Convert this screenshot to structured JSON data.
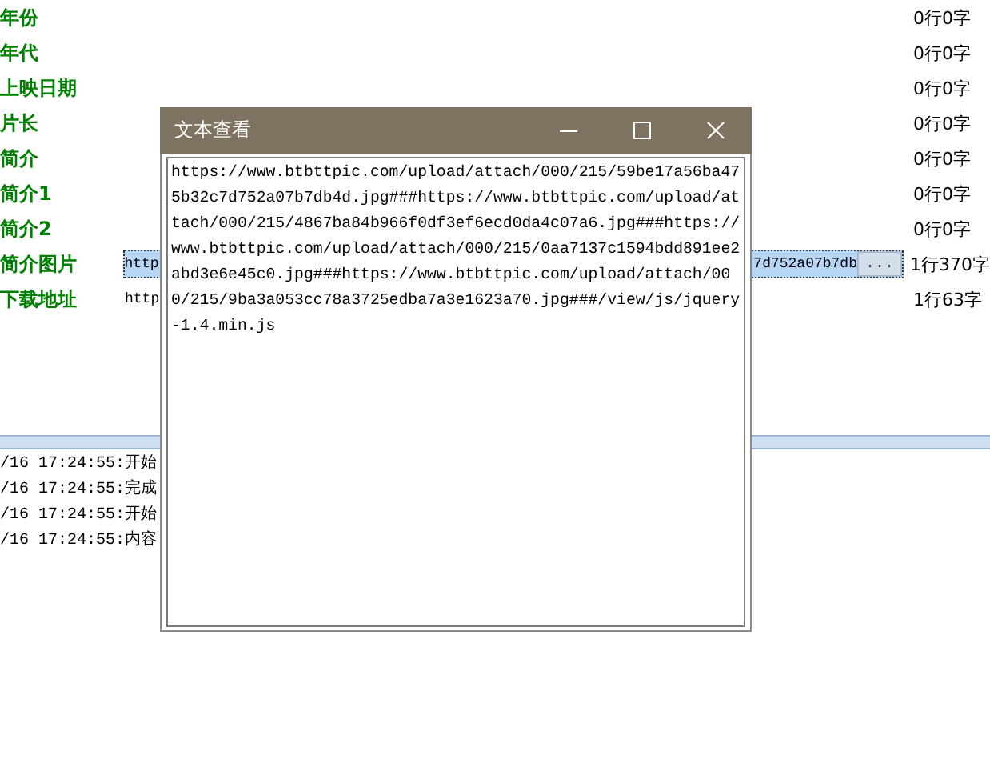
{
  "fields": [
    {
      "label": "年份",
      "selected": false,
      "count": "0行0字"
    },
    {
      "label": "年代",
      "selected": false,
      "count": "0行0字"
    },
    {
      "label": "上映日期",
      "selected": false,
      "count": "0行0字"
    },
    {
      "label": "片长",
      "selected": false,
      "count": "0行0字"
    },
    {
      "label": "简介",
      "selected": false,
      "count": "0行0字"
    },
    {
      "label": "简介1",
      "selected": false,
      "count": "0行0字"
    },
    {
      "label": "简介2",
      "selected": false,
      "count": "0行0字"
    },
    {
      "label": "简介图片",
      "selected": true,
      "value_start": "http",
      "value_end": "7d752a07b7db",
      "button": "...",
      "count": "1行370字"
    },
    {
      "label": "下载地址",
      "selected": false,
      "value_start": "http",
      "count": "1行63字"
    }
  ],
  "log": [
    "/16 17:24:55:开始",
    "/16 17:24:55:完成",
    "/16 17:24:55:开始",
    "/16 17:24:55:内容"
  ],
  "dialog": {
    "title": "文本查看",
    "text": "https://www.btbttpic.com/upload/attach/000/215/59be17a56ba475b32c7d752a07b7db4d.jpg###https://www.btbttpic.com/upload/attach/000/215/4867ba84b966f0df3ef6ecd0da4c07a6.jpg###https://www.btbttpic.com/upload/attach/000/215/0aa7137c1594bdd891ee2abd3e6e45c0.jpg###https://www.btbttpic.com/upload/attach/000/215/9ba3a053cc78a3725edba7a3e1623a70.jpg###/view/js/jquery-1.4.min.js"
  }
}
